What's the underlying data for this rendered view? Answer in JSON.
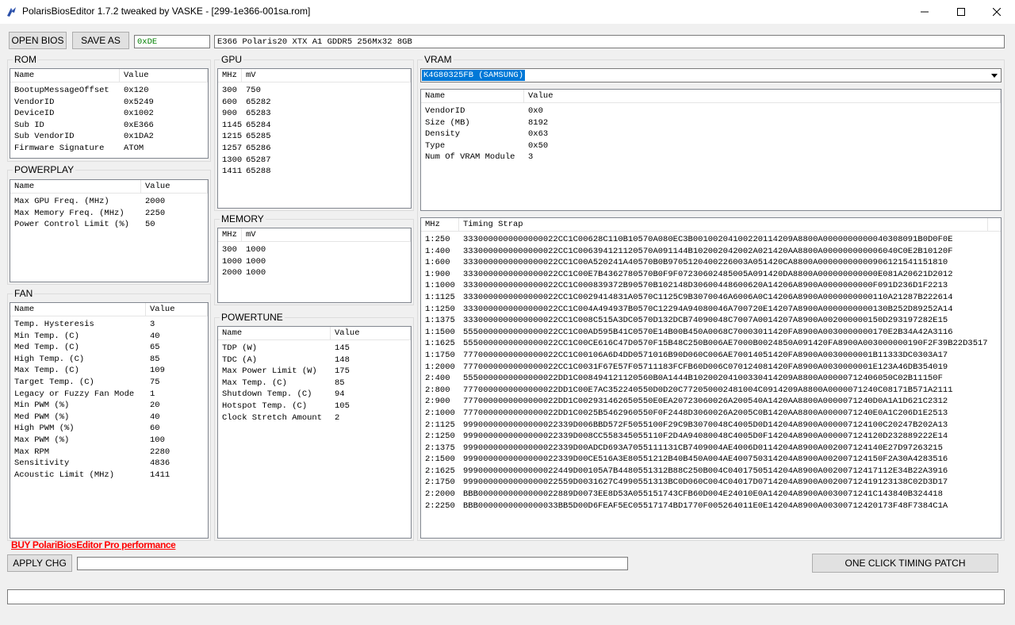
{
  "window": {
    "title": "PolarisBiosEditor 1.7.2 tweaked by VASKE - [299-1e366-001sa.rom]",
    "icon": "polaris-app-icon",
    "controls": [
      "minimize-icon",
      "maximize-icon",
      "close-icon"
    ]
  },
  "toolbar": {
    "open_label": "OPEN BIOS",
    "save_label": "SAVE AS",
    "checksum": "0xDE",
    "rom_name": "E366 Polaris20 XTX A1 GDDR5 256Mx32 8GB"
  },
  "rom": {
    "title": "ROM",
    "columns": [
      "Name",
      "Value"
    ],
    "rows": [
      [
        "BootupMessageOffset",
        "0x120"
      ],
      [
        "VendorID",
        "0x5249"
      ],
      [
        "DeviceID",
        "0x1002"
      ],
      [
        "Sub ID",
        "0xE366"
      ],
      [
        "Sub VendorID",
        "0x1DA2"
      ],
      [
        "Firmware Signature",
        "ATOM"
      ]
    ]
  },
  "powerplay": {
    "title": "POWERPLAY",
    "columns": [
      "Name",
      "Value"
    ],
    "rows": [
      [
        "Max GPU Freq. (MHz)",
        "2000"
      ],
      [
        "Max Memory Freq. (MHz)",
        "2250"
      ],
      [
        "Power Control Limit (%)",
        "50"
      ]
    ]
  },
  "fan": {
    "title": "FAN",
    "columns": [
      "Name",
      "Value"
    ],
    "rows": [
      [
        "Temp. Hysteresis",
        "3"
      ],
      [
        "Min Temp. (C)",
        "40"
      ],
      [
        "Med Temp. (C)",
        "65"
      ],
      [
        "High Temp. (C)",
        "85"
      ],
      [
        "Max Temp. (C)",
        "109"
      ],
      [
        "Target Temp. (C)",
        "75"
      ],
      [
        "Legacy or Fuzzy Fan Mode",
        "1"
      ],
      [
        "Min PWM (%)",
        "20"
      ],
      [
        "Med PWM (%)",
        "40"
      ],
      [
        "High PWM (%)",
        "60"
      ],
      [
        "Max PWM (%)",
        "100"
      ],
      [
        "Max RPM",
        "2280"
      ],
      [
        "Sensitivity",
        "4836"
      ],
      [
        "Acoustic Limit (MHz)",
        "1411"
      ]
    ]
  },
  "gpu": {
    "title": "GPU",
    "columns": [
      "MHz",
      "mV"
    ],
    "rows": [
      [
        "300",
        "750"
      ],
      [
        "600",
        "65282"
      ],
      [
        "900",
        "65283"
      ],
      [
        "1145",
        "65284"
      ],
      [
        "1215",
        "65285"
      ],
      [
        "1257",
        "65286"
      ],
      [
        "1300",
        "65287"
      ],
      [
        "1411",
        "65288"
      ]
    ]
  },
  "memory": {
    "title": "MEMORY",
    "columns": [
      "MHz",
      "mV"
    ],
    "rows": [
      [
        "300",
        "1000"
      ],
      [
        "1000",
        "1000"
      ],
      [
        "2000",
        "1000"
      ]
    ]
  },
  "powertune": {
    "title": "POWERTUNE",
    "columns": [
      "Name",
      "Value"
    ],
    "rows": [
      [
        "TDP (W)",
        "145"
      ],
      [
        "TDC (A)",
        "148"
      ],
      [
        "Max Power Limit (W)",
        "175"
      ],
      [
        "Max Temp. (C)",
        "85"
      ],
      [
        "Shutdown Temp. (C)",
        "94"
      ],
      [
        "Hotspot Temp. (C)",
        "105"
      ],
      [
        "Clock Stretch Amount",
        "2"
      ]
    ]
  },
  "vram": {
    "title": "VRAM",
    "selected": "K4G80325FB (SAMSUNG)",
    "columns": [
      "Name",
      "Value"
    ],
    "rows": [
      [
        "VendorID",
        "0x0"
      ],
      [
        "Size (MB)",
        "8192"
      ],
      [
        "Density",
        "0x63"
      ],
      [
        "Type",
        "0x50"
      ],
      [
        "Num Of VRAM Module",
        "3"
      ]
    ]
  },
  "timing": {
    "columns": [
      "MHz",
      "Timing Strap"
    ],
    "rows": [
      [
        "1:250",
        "3330000000000000022CC1C00628C110B10570A080EC3B0010020410022011420 9A8800A000000000004030809 1B0D0F0E"
      ],
      [
        "1:400",
        "3330000000000000022CC1C006394121120570A091144B10200204200 2A021420AA8800A00000000000 6040C0E2B10120F"
      ],
      [
        "1:600",
        "3330000000000000022CC1C00A520241A40570B0B97051204002260 03A051420CA8800A00000000000 906121541151810"
      ],
      [
        "1:900",
        "3330000000000000022CC1C00E7B436278057 0B0F9F07230602485005A091420DA8800A000000000000E081A20621D2012"
      ],
      [
        "1:1000",
        "3330000000000000022CC1C000839372B90570B102148D30600448 600620A1420 6A8900A0000000000F091D236D1F2213"
      ],
      [
        "1:1125",
        "3330000000000000022CC1C0029414831A0570C1125C9B3070046A6 006A0C1420 6A8900A0000000000110A21287B222614"
      ],
      [
        "1:1250",
        "3330000000000000022CC1C004A494937B0570C12294A9408004 6A700720E14207A8900A0000000000130B252D8 9252A14"
      ],
      [
        "1:1375",
        "3330000000000000022CC1C008C515A3DC0570D132DCB7409004 8C7007A0014207A8900A002000000150D29319728 2E15"
      ],
      [
        "1:1500",
        "5550000000000000022CC1C00AD595B41C0570E14B00B450A00 68C70003011420FA8900A003000000017 0E2B34A42A3116"
      ],
      [
        "1:1625",
        "5550000000000000022CC1C00CE616C47D0570F15B48C250B006A E7000B0024850A091420FA8900A003000000190F2F39B22D3517"
      ],
      [
        "1:1750",
        "7770000000000000022CC1C00106A 6D4DD0571016B90D060C006AE70014051420FA8900A003000000 1B1133 3DC0303A17"
      ],
      [
        "1:2000",
        "7770000000000000022CC1C0031F67E57F05711183FCFB60D006C07012408142 0FA8900A0030000001E12 3A46DB354019"
      ],
      [
        "2:400",
        "5550000000000000022DD1C008494121120560B0A1444B102002041003 3041420 9A8800A00000712406050C02B11150F"
      ],
      [
        "2:800",
        "7770000000000000022DD1C00E7AC352240550D0D20C772050002481004C09142 09A8800A000007124 0C08171B571A2111"
      ],
      [
        "2:900",
        "7770000000000000022DD1C002931462650550E0EA207230600 26A200540A1420AA8800A000007124 0D0A1A1D621C2312"
      ],
      [
        "2:1000",
        "7770000000000000022DD1C0025B5462960550F0F2448D306002 6A2005C0B1420AA8800A000007124 0E0A1C206D1E2513"
      ],
      [
        "2:1125",
        "9990000000000000022339D006BBD572F5055100F29C9B30700 48C4005D0D1420 4A8900A000007124100C20247B202A13"
      ],
      [
        "2:1250",
        "9990000000000000022339D008CC558345055110F2D4A94080 04 8C4005D0F14204A8900A000007124120D232889222E14"
      ],
      [
        "2:1375",
        "9990000000000000022339D00ADCD693A7055111131CB7409004AE 4006D0114204A8900A0020071241 40E27D97263215"
      ],
      [
        "2:1500",
        "9990000000000000022339D00CE516A3E80551212B40B450A004AE 40075031420 4A8900A00200712 4150F2A30A4283516"
      ],
      [
        "2:1625",
        "9990000000000000022449D00105A7B448055131 2B88C250B004C04017505142 04A8900A00200712417112E34B22A3916"
      ],
      [
        "2:1750",
        "9990000000000000022559D0031627C4990551313B C0D060C004C04017D0714204A8900A0020071241 9123138C02D3D17"
      ],
      [
        "2:2000",
        "BBB0000000000000022889D0073EE8D53A055151743CFB60D004E 24010E0A14204A8900A003007124 1C143840B324418"
      ],
      [
        "2:2250",
        "BBB0000000000000033BB5D00D6FEAF5EC05517174BD1770F00526 4011E0E14204A8900A003007124 20173F48F7384C1A"
      ]
    ]
  },
  "bottom": {
    "buy_text": "BUY PolariBiosEditor Pro performance",
    "apply_label": "APPLY CHG",
    "apply_value": "",
    "timing_patch_label": "ONE CLICK TIMING PATCH",
    "status_text": ""
  }
}
